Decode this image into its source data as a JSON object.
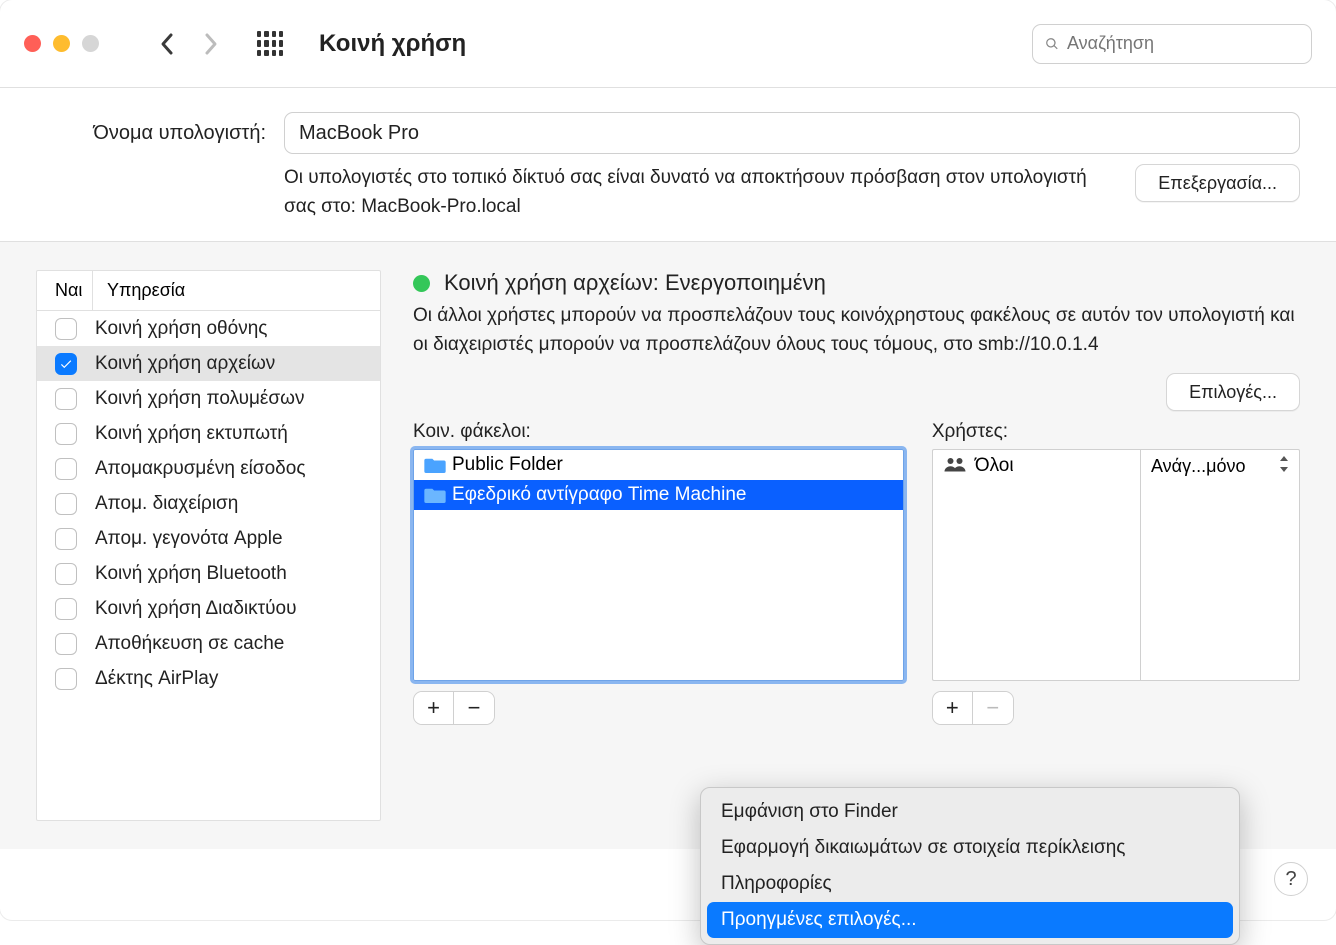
{
  "window": {
    "title": "Κοινή χρήση",
    "search_placeholder": "Αναζήτηση"
  },
  "computer_name": {
    "label": "Όνομα υπολογιστή:",
    "value": "MacBook Pro",
    "help": "Οι υπολογιστές στο τοπικό δίκτυό σας είναι δυνατό να αποκτήσουν πρόσβαση στον υπολογιστή σας στο: MacBook-Pro.local",
    "edit_button": "Επεξεργασία..."
  },
  "services": {
    "col_on": "Ναι",
    "col_name": "Υπηρεσία",
    "items": [
      {
        "label": "Κοινή χρήση οθόνης",
        "checked": false,
        "selected": false
      },
      {
        "label": "Κοινή χρήση αρχείων",
        "checked": true,
        "selected": true
      },
      {
        "label": "Κοινή χρήση πολυμέσων",
        "checked": false,
        "selected": false
      },
      {
        "label": "Κοινή χρήση εκτυπωτή",
        "checked": false,
        "selected": false
      },
      {
        "label": "Απομακρυσμένη είσοδος",
        "checked": false,
        "selected": false
      },
      {
        "label": "Απομ. διαχείριση",
        "checked": false,
        "selected": false
      },
      {
        "label": "Απομ. γεγονότα Apple",
        "checked": false,
        "selected": false
      },
      {
        "label": "Κοινή χρήση Bluetooth",
        "checked": false,
        "selected": false
      },
      {
        "label": "Κοινή χρήση Διαδικτύου",
        "checked": false,
        "selected": false
      },
      {
        "label": "Αποθήκευση σε cache",
        "checked": false,
        "selected": false
      },
      {
        "label": "Δέκτης AirPlay",
        "checked": false,
        "selected": false
      }
    ]
  },
  "detail": {
    "status_label": "Κοινή χρήση αρχείων: Ενεργοποιημένη",
    "description": "Οι άλλοι χρήστες μπορούν να προσπελάζουν τους κοινόχρηστους φακέλους σε αυτόν τον υπολογιστή και οι διαχειριστές μπορούν να προσπελάζουν όλους τους τόμους, στο smb://10.0.1.4",
    "options_button": "Επιλογές...",
    "folders_label": "Κοιν. φάκελοι:",
    "users_label": "Χρήστες:",
    "folders": [
      {
        "name": "Public Folder",
        "selected": false
      },
      {
        "name": "Εφεδρικό αντίγραφο Time Machine",
        "selected": true
      }
    ],
    "users": [
      {
        "name": "Όλοι",
        "permission": "Ανάγ...μόνο"
      }
    ]
  },
  "context_menu": {
    "items": [
      {
        "label": "Εμφάνιση στο Finder",
        "highlighted": false
      },
      {
        "label": "Εφαρμογή δικαιωμάτων σε στοιχεία περίκλεισης",
        "highlighted": false
      },
      {
        "label": "Πληροφορίες",
        "highlighted": false
      },
      {
        "label": "Προηγμένες επιλογές...",
        "highlighted": true
      }
    ]
  },
  "help_glyph": "?"
}
